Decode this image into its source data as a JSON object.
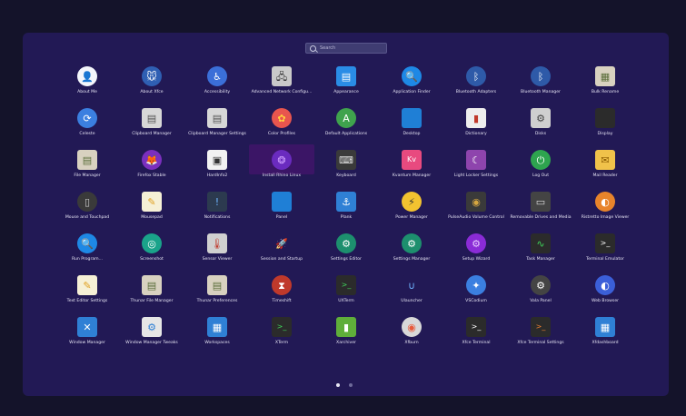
{
  "search": {
    "placeholder": "Search"
  },
  "pages": {
    "current": 1,
    "total": 2
  },
  "apps": [
    {
      "label": "About Me",
      "icon": "user-icon",
      "glyph": "👤",
      "bg": "#f4f6fb",
      "fg": "#3a7bd5",
      "shape": "circle"
    },
    {
      "label": "About Xfce",
      "icon": "xfce-mouse-icon",
      "glyph": "🐭",
      "bg": "#2f5fb3",
      "fg": "#ffffff",
      "shape": "circle"
    },
    {
      "label": "Accessibility",
      "icon": "accessibility-icon",
      "glyph": "♿",
      "bg": "#3b6fd8",
      "fg": "#ffffff",
      "shape": "circle"
    },
    {
      "label": "Advanced Network Configu...",
      "icon": "network-icon",
      "glyph": "🖧",
      "bg": "#c9c9c9",
      "fg": "#333333",
      "shape": "square"
    },
    {
      "label": "Appearance",
      "icon": "appearance-icon",
      "glyph": "▤",
      "bg": "#2a8ce6",
      "fg": "#ffffff",
      "shape": "square"
    },
    {
      "label": "Application Finder",
      "icon": "app-finder-icon",
      "glyph": "🔍",
      "bg": "#1e88e5",
      "fg": "#ffffff",
      "shape": "circle"
    },
    {
      "label": "Bluetooth Adapters",
      "icon": "bluetooth-icon",
      "glyph": "ᛒ",
      "bg": "#2e5aa8",
      "fg": "#ffffff",
      "shape": "circle"
    },
    {
      "label": "Bluetooth Manager",
      "icon": "bluetooth-icon",
      "glyph": "ᛒ",
      "bg": "#2e5aa8",
      "fg": "#ffffff",
      "shape": "circle"
    },
    {
      "label": "Bulk Rename",
      "icon": "bulk-rename-icon",
      "glyph": "▦",
      "bg": "#d8d1c0",
      "fg": "#5a6d3a",
      "shape": "square"
    },
    {
      "label": "Celeste",
      "icon": "celeste-sync-icon",
      "glyph": "⟳",
      "bg": "#3b7fe0",
      "fg": "#ffffff",
      "shape": "circle"
    },
    {
      "label": "Clipboard Manager",
      "icon": "clipboard-icon",
      "glyph": "▤",
      "bg": "#d7d7d7",
      "fg": "#555555",
      "shape": "square"
    },
    {
      "label": "Clipboard Manager Settings",
      "icon": "clipboard-settings-icon",
      "glyph": "▤",
      "bg": "#d7d7d7",
      "fg": "#555555",
      "shape": "square"
    },
    {
      "label": "Color Profiles",
      "icon": "color-profiles-icon",
      "glyph": "✿",
      "bg": "#e8554e",
      "fg": "#ffd23f",
      "shape": "circle"
    },
    {
      "label": "Default Applications",
      "icon": "default-apps-icon",
      "glyph": "A",
      "bg": "#3fa34d",
      "fg": "#ffffff",
      "shape": "circle"
    },
    {
      "label": "Desktop",
      "icon": "desktop-icon",
      "glyph": "",
      "bg": "#1f7fd6",
      "fg": "#ffffff",
      "shape": "square"
    },
    {
      "label": "Dictionary",
      "icon": "dictionary-icon",
      "glyph": "▮",
      "bg": "#eeeeee",
      "fg": "#c0392b",
      "shape": "square"
    },
    {
      "label": "Disks",
      "icon": "disks-icon",
      "glyph": "⚙",
      "bg": "#cfcfcf",
      "fg": "#444444",
      "shape": "square"
    },
    {
      "label": "Display",
      "icon": "display-icon",
      "glyph": "",
      "bg": "#2b2b2b",
      "fg": "#ffffff",
      "shape": "square"
    },
    {
      "label": "File Manager",
      "icon": "file-manager-icon",
      "glyph": "▤",
      "bg": "#d8d1c0",
      "fg": "#5a6d3a",
      "shape": "square"
    },
    {
      "label": "Firefox Stable",
      "icon": "firefox-icon",
      "glyph": "🦊",
      "bg": "#7b2fbe",
      "fg": "#ff9a2e",
      "shape": "circle"
    },
    {
      "label": "HardInfo2",
      "icon": "hardinfo-icon",
      "glyph": "▣",
      "bg": "#f2f2f2",
      "fg": "#333333",
      "shape": "square"
    },
    {
      "label": "Install Rhino Linux",
      "icon": "rhino-linux-icon",
      "glyph": "❂",
      "bg": "#6a2bbf",
      "fg": "#d0a0ff",
      "shape": "circle",
      "selected": true
    },
    {
      "label": "Keyboard",
      "icon": "keyboard-icon",
      "glyph": "⌨",
      "bg": "#3a3a3a",
      "fg": "#e0e0e0",
      "shape": "square"
    },
    {
      "label": "Kvantum Manager",
      "icon": "kvantum-icon",
      "glyph": "Kv",
      "bg": "#e84a7f",
      "fg": "#ffffff",
      "shape": "square"
    },
    {
      "label": "Light Locker Settings",
      "icon": "light-locker-icon",
      "glyph": "☾",
      "bg": "#8e44ad",
      "fg": "#ffffff",
      "shape": "square"
    },
    {
      "label": "Log Out",
      "icon": "log-out-icon",
      "glyph": "⏻",
      "bg": "#2ea44f",
      "fg": "#ffffff",
      "shape": "circle"
    },
    {
      "label": "Mail Reader",
      "icon": "mail-reader-icon",
      "glyph": "✉",
      "bg": "#f0c24a",
      "fg": "#8a5a00",
      "shape": "square"
    },
    {
      "label": "Mouse and Touchpad",
      "icon": "mouse-icon",
      "glyph": "▯",
      "bg": "#3a3a3a",
      "fg": "#cccccc",
      "shape": "circle"
    },
    {
      "label": "Mousepad",
      "icon": "mousepad-icon",
      "glyph": "✎",
      "bg": "#f6f0d6",
      "fg": "#e0a020",
      "shape": "square"
    },
    {
      "label": "Notifications",
      "icon": "notifications-icon",
      "glyph": "!",
      "bg": "#2c3a4f",
      "fg": "#6fb4ff",
      "shape": "square"
    },
    {
      "label": "Panel",
      "icon": "panel-icon",
      "glyph": "",
      "bg": "#1f7fd6",
      "fg": "#ffffff",
      "shape": "square"
    },
    {
      "label": "Plank",
      "icon": "plank-icon",
      "glyph": "⚓",
      "bg": "#2f80d5",
      "fg": "#ffffff",
      "shape": "square"
    },
    {
      "label": "Power Manager",
      "icon": "power-manager-icon",
      "glyph": "⚡",
      "bg": "#f2c230",
      "fg": "#333333",
      "shape": "circle"
    },
    {
      "label": "PulseAudio Volume Control",
      "icon": "speaker-icon",
      "glyph": "◉",
      "bg": "#3a3a3a",
      "fg": "#d6a640",
      "shape": "square"
    },
    {
      "label": "Removable Drives and Media",
      "icon": "removable-drive-icon",
      "glyph": "▭",
      "bg": "#444444",
      "fg": "#dddddd",
      "shape": "square"
    },
    {
      "label": "Ristretto Image Viewer",
      "icon": "image-viewer-icon",
      "glyph": "◐",
      "bg": "#e8842b",
      "fg": "#ffffff",
      "shape": "circle"
    },
    {
      "label": "Run Program...",
      "icon": "run-program-icon",
      "glyph": "🔍",
      "bg": "#1e88e5",
      "fg": "#ffffff",
      "shape": "circle"
    },
    {
      "label": "Screenshot",
      "icon": "screenshot-icon",
      "glyph": "◎",
      "bg": "#1aa38a",
      "fg": "#ffffff",
      "shape": "circle"
    },
    {
      "label": "Sensor Viewer",
      "icon": "sensor-viewer-icon",
      "glyph": "🌡",
      "bg": "#d0d0d0",
      "fg": "#c0392b",
      "shape": "square"
    },
    {
      "label": "Session and Startup",
      "icon": "session-startup-icon",
      "glyph": "🚀",
      "bg": "#221955",
      "fg": "#e85a3a",
      "shape": "square"
    },
    {
      "label": "Settings Editor",
      "icon": "settings-editor-icon",
      "glyph": "⚙",
      "bg": "#1d8f6e",
      "fg": "#ffffff",
      "shape": "circle"
    },
    {
      "label": "Settings Manager",
      "icon": "settings-manager-icon",
      "glyph": "⚙",
      "bg": "#1d8f6e",
      "fg": "#ffffff",
      "shape": "circle"
    },
    {
      "label": "Setup Wizard",
      "icon": "setup-wizard-icon",
      "glyph": "⚙",
      "bg": "#8a2bd6",
      "fg": "#e6c8ff",
      "shape": "circle"
    },
    {
      "label": "Task Manager",
      "icon": "task-manager-icon",
      "glyph": "∿",
      "bg": "#2b2b2b",
      "fg": "#3fd45a",
      "shape": "square"
    },
    {
      "label": "Terminal Emulator",
      "icon": "terminal-icon",
      "glyph": ">_",
      "bg": "#2b2b2b",
      "fg": "#ffffff",
      "shape": "square"
    },
    {
      "label": "Text Editor Settings",
      "icon": "text-editor-settings-icon",
      "glyph": "✎",
      "bg": "#f6f0d6",
      "fg": "#e0a020",
      "shape": "square"
    },
    {
      "label": "Thunar File Manager",
      "icon": "thunar-icon",
      "glyph": "▤",
      "bg": "#d8d1c0",
      "fg": "#5a6d3a",
      "shape": "square"
    },
    {
      "label": "Thunar Preferences",
      "icon": "thunar-preferences-icon",
      "glyph": "▤",
      "bg": "#d8d1c0",
      "fg": "#5a6d3a",
      "shape": "square"
    },
    {
      "label": "Timeshift",
      "icon": "timeshift-icon",
      "glyph": "⧗",
      "bg": "#c0392b",
      "fg": "#ffffff",
      "shape": "circle"
    },
    {
      "label": "UXTerm",
      "icon": "uxterm-icon",
      "glyph": ">_",
      "bg": "#2b2b2b",
      "fg": "#3fd45a",
      "shape": "square"
    },
    {
      "label": "Ulauncher",
      "icon": "ulauncher-icon",
      "glyph": "∪",
      "bg": "#221955",
      "fg": "#6fb4ff",
      "shape": "square"
    },
    {
      "label": "VSCodium",
      "icon": "vscodium-icon",
      "glyph": "✦",
      "bg": "#3b7fe0",
      "fg": "#ffffff",
      "shape": "circle"
    },
    {
      "label": "Vala Panel",
      "icon": "vala-panel-icon",
      "glyph": "⚙",
      "bg": "#444444",
      "fg": "#ffffff",
      "shape": "circle"
    },
    {
      "label": "Web Browser",
      "icon": "web-browser-icon",
      "glyph": "◐",
      "bg": "#3b5fd8",
      "fg": "#ffffff",
      "shape": "circle"
    },
    {
      "label": "Window Manager",
      "icon": "window-manager-icon",
      "glyph": "✕",
      "bg": "#2f80d5",
      "fg": "#ffffff",
      "shape": "square"
    },
    {
      "label": "Window Manager Tweaks",
      "icon": "window-manager-tweaks-icon",
      "glyph": "⚙",
      "bg": "#e6e6e6",
      "fg": "#2f80d5",
      "shape": "square"
    },
    {
      "label": "Workspaces",
      "icon": "workspaces-icon",
      "glyph": "▦",
      "bg": "#2f80d5",
      "fg": "#ffffff",
      "shape": "square"
    },
    {
      "label": "XTerm",
      "icon": "xterm-icon",
      "glyph": ">_",
      "bg": "#2b2b2b",
      "fg": "#3fd45a",
      "shape": "square"
    },
    {
      "label": "Xarchiver",
      "icon": "xarchiver-icon",
      "glyph": "▮",
      "bg": "#5fae3a",
      "fg": "#ffffff",
      "shape": "square"
    },
    {
      "label": "Xfburn",
      "icon": "xfburn-icon",
      "glyph": "◉",
      "bg": "#d8d8d8",
      "fg": "#e85a3a",
      "shape": "circle"
    },
    {
      "label": "Xfce Terminal",
      "icon": "xfce-terminal-icon",
      "glyph": ">_",
      "bg": "#2b2b2b",
      "fg": "#ffffff",
      "shape": "square"
    },
    {
      "label": "Xfce Terminal Settings",
      "icon": "xfce-terminal-settings-icon",
      "glyph": ">_",
      "bg": "#2b2b2b",
      "fg": "#f08030",
      "shape": "square"
    },
    {
      "label": "Xfdashboard",
      "icon": "xfdashboard-icon",
      "glyph": "▦",
      "bg": "#2f80d5",
      "fg": "#ffffff",
      "shape": "square"
    }
  ]
}
